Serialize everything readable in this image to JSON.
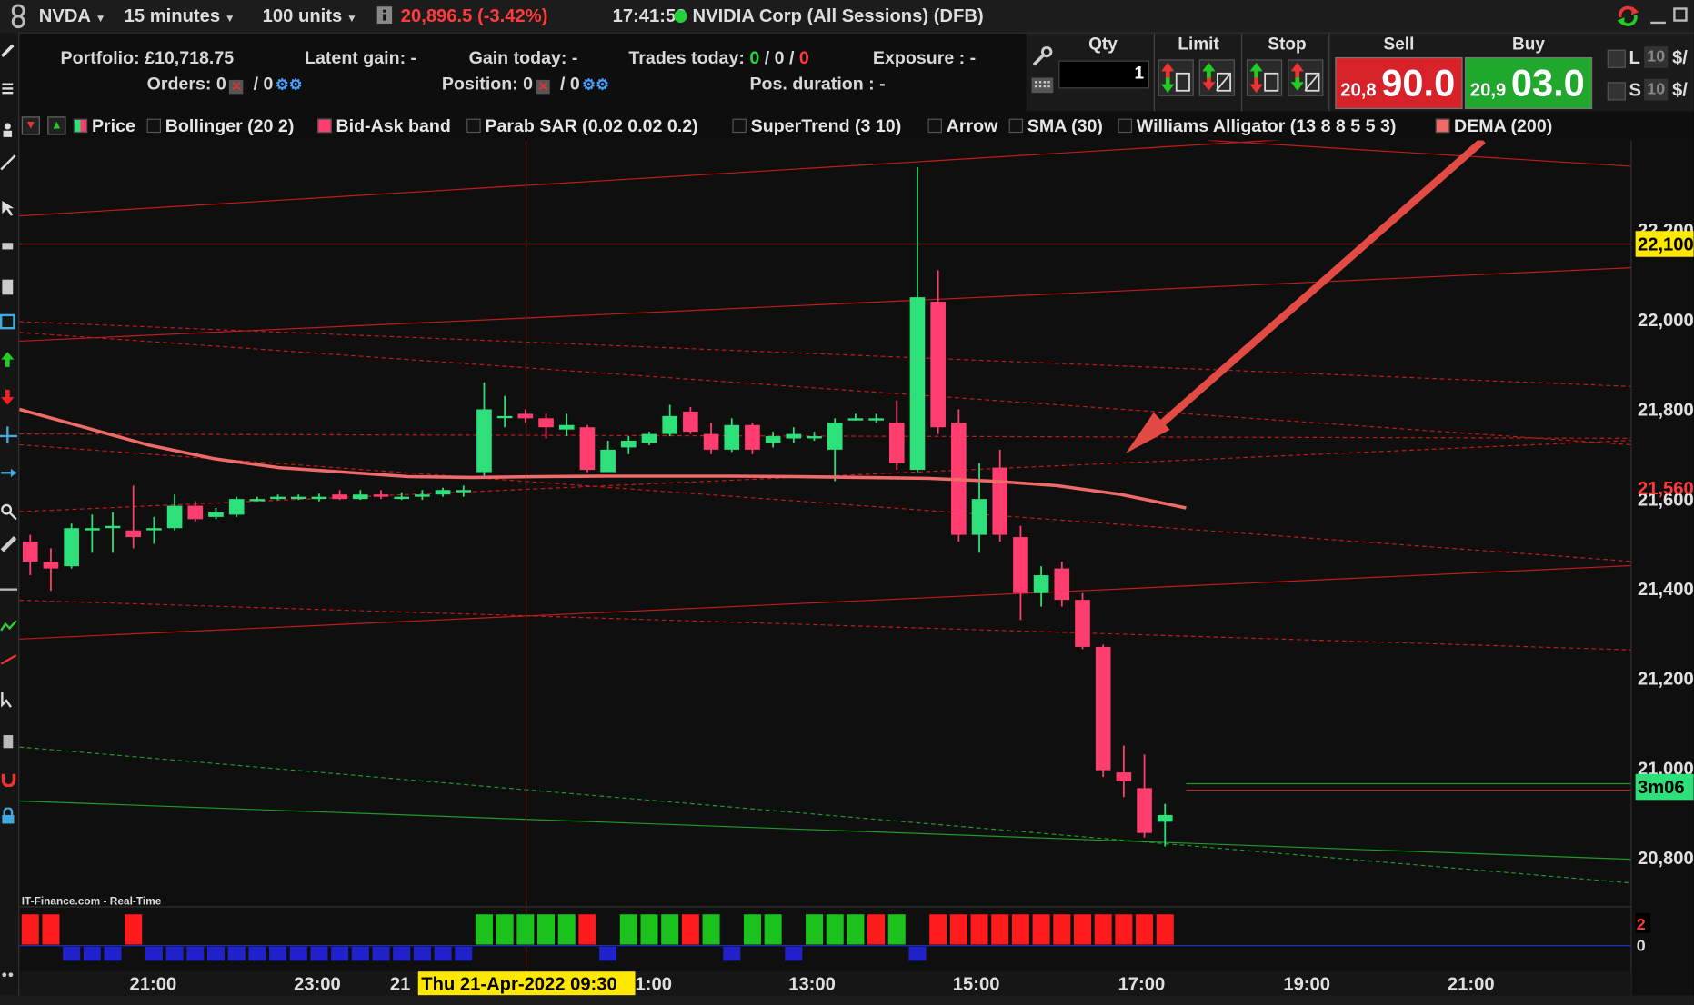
{
  "toolbar": {
    "symbol": "NVDA",
    "timeframe": "15 minutes",
    "units": "100 units",
    "last_change": "20,896.5 (-3.42%)",
    "clock": "17:41:53",
    "instrument": "NVIDIA Corp (All Sessions) (DFB)"
  },
  "portfolio": {
    "portfolio_label": "Portfolio: £10,718.75",
    "latent_label": "Latent gain: -",
    "gain_today_label": "Gain today: -",
    "trades_label": "Trades today:",
    "trades_a": "0",
    "trades_b": "0",
    "trades_c": "0",
    "exposure_label": "Exposure : -",
    "orders_label": "Orders: 0",
    "orders_b": "0",
    "position_label": "Position: 0",
    "position_b": "0",
    "pos_duration_label": "Pos. duration : -"
  },
  "order": {
    "qty_header": "Qty",
    "limit_header": "Limit",
    "stop_header": "Stop",
    "sell_header": "Sell",
    "buy_header": "Buy",
    "qty_value": "1",
    "sell_small": "20,8",
    "sell_big": "90.0",
    "buy_small": "20,9",
    "buy_big": "03.0",
    "side_l": "L",
    "side_s": "S",
    "side_qty": "10",
    "side_unit": "$/"
  },
  "legend": {
    "price": "Price",
    "bollinger": "Bollinger (20 2)",
    "bidask": "Bid-Ask band",
    "psar": "Parab SAR (0.02 0.02 0.2)",
    "supertrend": "SuperTrend (3 10)",
    "arrow": "Arrow",
    "sma": "SMA (30)",
    "alligator": "Williams Alligator (13 8 8 5 5 3)",
    "dema": "DEMA (200)"
  },
  "watermark": "IT-Finance.com - Real-Time",
  "colors": {
    "up_candle": "#2ee07a",
    "down_candle": "#ff3d6e",
    "dema": "#f06a6a",
    "sell_bg": "#d8222a",
    "buy_bg": "#1fa82b",
    "trend_red": "#c21b1b",
    "trend_green": "#1f9a2a"
  },
  "chart_data": {
    "type": "candlestick",
    "price_ticks": [
      "22,200",
      "22,000",
      "21,800",
      "21,600",
      "21,400",
      "21,200",
      "21,000",
      "20,800"
    ],
    "price_tick_values": [
      22200,
      22000,
      21800,
      21600,
      21400,
      21200,
      21000,
      20800
    ],
    "ylim": [
      20700,
      22400
    ],
    "highlighted_price_1": "22,100",
    "highlighted_price_2": "21,560",
    "countdown_label": "3m06",
    "time_ticks": [
      "21:00",
      "23:00",
      "21",
      "1:00",
      "13:00",
      "15:00",
      "17:00",
      "19:00",
      "21:00"
    ],
    "crosshair_time": "Thu 21-Apr-2022 09:30",
    "candles": [
      [
        21505,
        21460,
        21520,
        21430
      ],
      [
        21460,
        21445,
        21490,
        21395
      ],
      [
        21450,
        21535,
        21545,
        21445
      ],
      [
        21530,
        21535,
        21565,
        21480
      ],
      [
        21535,
        21540,
        21570,
        21480
      ],
      [
        21530,
        21515,
        21630,
        21490
      ],
      [
        21535,
        21535,
        21560,
        21500
      ],
      [
        21535,
        21585,
        21610,
        21530
      ],
      [
        21585,
        21555,
        21595,
        21550
      ],
      [
        21560,
        21570,
        21580,
        21555
      ],
      [
        21565,
        21600,
        21605,
        21560
      ],
      [
        21600,
        21600,
        21605,
        21595
      ],
      [
        21600,
        21605,
        21610,
        21598
      ],
      [
        21605,
        21605,
        21610,
        21598
      ],
      [
        21600,
        21605,
        21612,
        21595
      ],
      [
        21610,
        21600,
        21620,
        21598
      ],
      [
        21600,
        21610,
        21620,
        21598
      ],
      [
        21610,
        21605,
        21620,
        21600
      ],
      [
        21605,
        21605,
        21615,
        21598
      ],
      [
        21605,
        21610,
        21620,
        21598
      ],
      [
        21610,
        21620,
        21625,
        21605
      ],
      [
        21620,
        21620,
        21630,
        21605
      ],
      [
        21660,
        21800,
        21860,
        21650
      ],
      [
        21785,
        21785,
        21830,
        21760
      ],
      [
        21790,
        21780,
        21800,
        21770
      ],
      [
        21780,
        21760,
        21790,
        21735
      ],
      [
        21755,
        21765,
        21790,
        21740
      ],
      [
        21760,
        21665,
        21765,
        21660
      ],
      [
        21660,
        21710,
        21730,
        21660
      ],
      [
        21715,
        21730,
        21740,
        21700
      ],
      [
        21725,
        21745,
        21750,
        21720
      ],
      [
        21745,
        21785,
        21810,
        21740
      ],
      [
        21795,
        21750,
        21805,
        21745
      ],
      [
        21745,
        21710,
        21770,
        21700
      ],
      [
        21710,
        21765,
        21780,
        21705
      ],
      [
        21765,
        21710,
        21770,
        21700
      ],
      [
        21725,
        21740,
        21750,
        21715
      ],
      [
        21735,
        21745,
        21760,
        21725
      ],
      [
        21740,
        21740,
        21750,
        21730
      ],
      [
        21710,
        21770,
        21780,
        21640
      ],
      [
        21780,
        21780,
        21790,
        21775
      ],
      [
        21780,
        21780,
        21790,
        21770
      ],
      [
        21770,
        21680,
        21820,
        21665
      ],
      [
        21665,
        22050,
        22340,
        21660
      ],
      [
        22040,
        21760,
        22110,
        21745
      ],
      [
        21770,
        21520,
        21800,
        21505
      ],
      [
        21520,
        21600,
        21680,
        21480
      ],
      [
        21670,
        21520,
        21710,
        21505
      ],
      [
        21515,
        21390,
        21540,
        21330
      ],
      [
        21390,
        21430,
        21450,
        21360
      ],
      [
        21445,
        21375,
        21460,
        21360
      ],
      [
        21375,
        21270,
        21390,
        21265
      ],
      [
        21270,
        20995,
        21275,
        20980
      ],
      [
        20990,
        20970,
        21050,
        20935
      ],
      [
        20955,
        20855,
        21030,
        20845
      ],
      [
        20880,
        20895,
        20920,
        20825
      ]
    ],
    "dema": [
      21800,
      21760,
      21720,
      21690,
      21670,
      21660,
      21650,
      21648,
      21650,
      21651,
      21651,
      21651,
      21650,
      21648,
      21646,
      21640,
      21630,
      21610,
      21580
    ],
    "volume_bars": [
      {
        "value": 1,
        "up": false
      },
      {
        "value": 1,
        "up": false
      },
      {
        "value": 0,
        "up": null
      },
      {
        "value": 0,
        "up": null
      },
      {
        "value": 0,
        "up": null
      },
      {
        "value": 1,
        "up": false
      },
      {
        "value": 0,
        "up": null
      },
      {
        "value": 0,
        "up": null
      },
      {
        "value": 0,
        "up": null
      },
      {
        "value": 0,
        "up": null
      },
      {
        "value": 0,
        "up": null
      },
      {
        "value": 0,
        "up": null
      },
      {
        "value": 0,
        "up": null
      },
      {
        "value": 0,
        "up": null
      },
      {
        "value": 0,
        "up": null
      },
      {
        "value": 0,
        "up": null
      },
      {
        "value": 0,
        "up": null
      },
      {
        "value": 0,
        "up": null
      },
      {
        "value": 0,
        "up": null
      },
      {
        "value": 0,
        "up": null
      },
      {
        "value": 0,
        "up": null
      },
      {
        "value": 0,
        "up": null
      },
      {
        "value": 1,
        "up": true
      },
      {
        "value": 1,
        "up": true
      },
      {
        "value": 1,
        "up": true
      },
      {
        "value": 1,
        "up": true
      },
      {
        "value": 1,
        "up": true
      },
      {
        "value": 1,
        "up": false
      },
      {
        "value": 0,
        "up": null
      },
      {
        "value": 1,
        "up": true
      },
      {
        "value": 1,
        "up": true
      },
      {
        "value": 1,
        "up": true
      },
      {
        "value": 1,
        "up": false
      },
      {
        "value": 1,
        "up": true
      },
      {
        "value": 0,
        "up": null
      },
      {
        "value": 1,
        "up": true
      },
      {
        "value": 1,
        "up": true
      },
      {
        "value": 0,
        "up": null
      },
      {
        "value": 1,
        "up": true
      },
      {
        "value": 1,
        "up": true
      },
      {
        "value": 1,
        "up": true
      },
      {
        "value": 1,
        "up": false
      },
      {
        "value": 1,
        "up": true
      },
      {
        "value": 0,
        "up": null
      },
      {
        "value": 1,
        "up": false
      },
      {
        "value": 1,
        "up": false
      },
      {
        "value": 1,
        "up": false
      },
      {
        "value": 1,
        "up": false
      },
      {
        "value": 1,
        "up": false
      },
      {
        "value": 1,
        "up": false
      },
      {
        "value": 1,
        "up": false
      },
      {
        "value": 1,
        "up": false
      },
      {
        "value": 1,
        "up": false
      },
      {
        "value": 1,
        "up": false
      },
      {
        "value": 1,
        "up": false
      },
      {
        "value": 1,
        "up": false
      }
    ],
    "volume_axis_labels": [
      "2",
      "0"
    ]
  }
}
